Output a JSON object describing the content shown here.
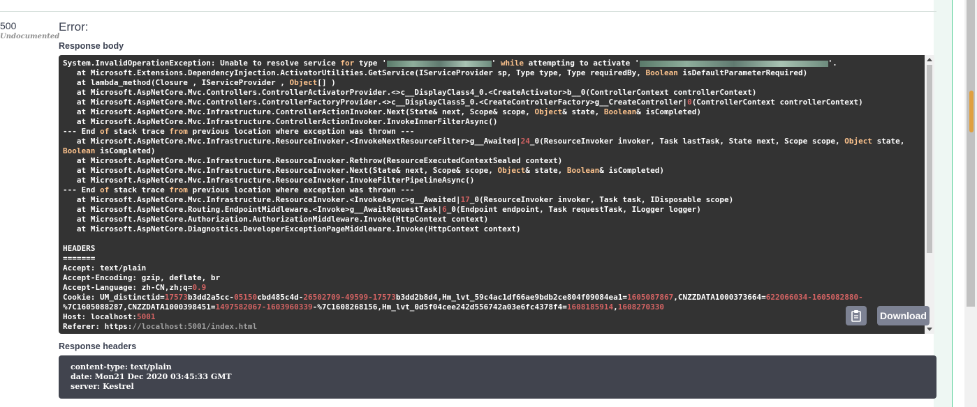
{
  "response": {
    "status_code": "500",
    "status_doc": "Undocumented",
    "error_title": "Error:",
    "body_label": "Response body",
    "headers_label": "Response headers",
    "download_label": "Download",
    "copy_icon": "clipboard-icon",
    "body_lines": [
      [
        {
          "t": "System.InvalidOperationException: Unable to resolve service "
        },
        {
          "t": "for",
          "c": "kw"
        },
        {
          "t": " type '"
        },
        {
          "m": 150
        },
        {
          "t": "' "
        },
        {
          "t": "while",
          "c": "kw"
        },
        {
          "t": " attempting to activate '"
        },
        {
          "m": 270
        },
        {
          "t": "'."
        }
      ],
      [
        {
          "t": "   at Microsoft.Extensions.DependencyInjection.ActivatorUtilities.GetService(IServiceProvider sp, Type type, Type requiredBy, "
        },
        {
          "t": "Boolean",
          "c": "kw"
        },
        {
          "t": " isDefaultParameterRequired)"
        }
      ],
      [
        {
          "t": "   at lambda_method(Closure , IServiceProvider , "
        },
        {
          "t": "Object",
          "c": "kw"
        },
        {
          "t": "[] )"
        }
      ],
      [
        {
          "t": "   at Microsoft.AspNetCore.Mvc.Controllers.ControllerActivatorProvider.<>c__DisplayClass4_0.<CreateActivator>b__0(ControllerContext controllerContext)"
        }
      ],
      [
        {
          "t": "   at Microsoft.AspNetCore.Mvc.Controllers.ControllerFactoryProvider.<>c__DisplayClass5_0.<CreateControllerFactory>g__CreateController|"
        },
        {
          "t": "0",
          "c": "num"
        },
        {
          "t": "(ControllerContext controllerContext)"
        }
      ],
      [
        {
          "t": "   at Microsoft.AspNetCore.Mvc.Infrastructure.ControllerActionInvoker.Next(State& next, Scope& scope, "
        },
        {
          "t": "Object",
          "c": "kw"
        },
        {
          "t": "& state, "
        },
        {
          "t": "Boolean",
          "c": "kw"
        },
        {
          "t": "& isCompleted)"
        }
      ],
      [
        {
          "t": "   at Microsoft.AspNetCore.Mvc.Infrastructure.ControllerActionInvoker.InvokeInnerFilterAsync()"
        }
      ],
      [
        {
          "t": "--- End "
        },
        {
          "t": "of",
          "c": "kw"
        },
        {
          "t": " stack trace "
        },
        {
          "t": "from",
          "c": "kw"
        },
        {
          "t": " previous location where exception was thrown ---"
        }
      ],
      [
        {
          "t": "   at Microsoft.AspNetCore.Mvc.Infrastructure.ResourceInvoker.<InvokeNextResourceFilter>g__Awaited|"
        },
        {
          "t": "24",
          "c": "num"
        },
        {
          "t": "_0(ResourceInvoker invoker, Task lastTask, State next, Scope scope, "
        },
        {
          "t": "Object",
          "c": "kw"
        },
        {
          "t": " state, "
        }
      ],
      [
        {
          "t": "Boolean",
          "c": "kw"
        },
        {
          "t": " isCompleted)"
        }
      ],
      [
        {
          "t": "   at Microsoft.AspNetCore.Mvc.Infrastructure.ResourceInvoker.Rethrow(ResourceExecutedContextSealed context)"
        }
      ],
      [
        {
          "t": "   at Microsoft.AspNetCore.Mvc.Infrastructure.ResourceInvoker.Next(State& next, Scope& scope, "
        },
        {
          "t": "Object",
          "c": "kw"
        },
        {
          "t": "& state, "
        },
        {
          "t": "Boolean",
          "c": "kw"
        },
        {
          "t": "& isCompleted)"
        }
      ],
      [
        {
          "t": "   at Microsoft.AspNetCore.Mvc.Infrastructure.ResourceInvoker.InvokeFilterPipelineAsync()"
        }
      ],
      [
        {
          "t": "--- End "
        },
        {
          "t": "of",
          "c": "kw"
        },
        {
          "t": " stack trace "
        },
        {
          "t": "from",
          "c": "kw"
        },
        {
          "t": " previous location where exception was thrown ---"
        }
      ],
      [
        {
          "t": "   at Microsoft.AspNetCore.Mvc.Infrastructure.ResourceInvoker.<InvokeAsync>g__Awaited|"
        },
        {
          "t": "17",
          "c": "num"
        },
        {
          "t": "_0(ResourceInvoker invoker, Task task, IDisposable scope)"
        }
      ],
      [
        {
          "t": "   at Microsoft.AspNetCore.Routing.EndpointMiddleware.<Invoke>g__AwaitRequestTask|"
        },
        {
          "t": "6",
          "c": "num"
        },
        {
          "t": "_0(Endpoint endpoint, Task requestTask, ILogger logger)"
        }
      ],
      [
        {
          "t": "   at Microsoft.AspNetCore.Authorization.AuthorizationMiddleware.Invoke(HttpContext context)"
        }
      ],
      [
        {
          "t": "   at Microsoft.AspNetCore.Diagnostics.DeveloperExceptionPageMiddleware.Invoke(HttpContext context)"
        }
      ],
      [
        {
          "t": ""
        }
      ],
      [
        {
          "t": "HEADERS"
        }
      ],
      [
        {
          "t": "======="
        }
      ],
      [
        {
          "t": "Accept: text/plain"
        }
      ],
      [
        {
          "t": "Accept-Encoding: gzip, deflate, br"
        }
      ],
      [
        {
          "t": "Accept-Language: zh-CN,zh;q="
        },
        {
          "t": "0.9",
          "c": "num"
        }
      ],
      [
        {
          "t": "Cookie: UM_distinctid="
        },
        {
          "t": "17573",
          "c": "num"
        },
        {
          "t": "b3dd2a5cc-"
        },
        {
          "t": "05150",
          "c": "num"
        },
        {
          "t": "cbd485c4d-"
        },
        {
          "t": "26502709-49599-17573",
          "c": "num"
        },
        {
          "t": "b3dd2b8d4,Hm_lvt_59c4ac1df66ae9bdb2ce804f09084ea1="
        },
        {
          "t": "1605087867",
          "c": "num"
        },
        {
          "t": ",CNZZDATA1000373664="
        },
        {
          "t": "622066034-1605082880-",
          "c": "num"
        }
      ],
      [
        {
          "t": "%7C1605088287,CNZZDATA1000398451="
        },
        {
          "t": "1497582067-1603960339",
          "c": "num"
        },
        {
          "t": "-%7C1608268156,Hm_lvt_0d5f04cee242d556742a03e6fc4378f4="
        },
        {
          "t": "1608185914",
          "c": "num"
        },
        {
          "t": ","
        },
        {
          "t": "1608270330",
          "c": "num"
        }
      ],
      [
        {
          "t": "Host: localhost:"
        },
        {
          "t": "5001",
          "c": "num"
        }
      ],
      [
        {
          "t": "Referer: https:"
        },
        {
          "t": "//localhost:5001/index.html",
          "c": "dim"
        }
      ]
    ],
    "header_lines": [
      "content-type: text/plain",
      "date: Mon21 Dec 2020 03:45:33 GMT",
      "server: Kestrel"
    ]
  }
}
